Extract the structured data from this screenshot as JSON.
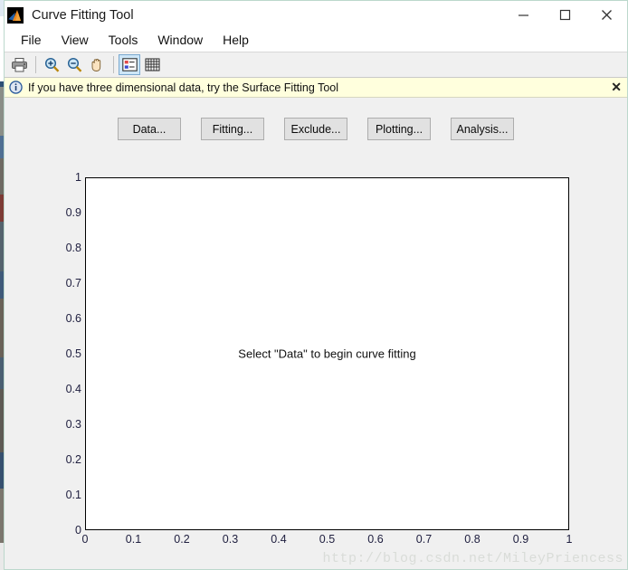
{
  "window": {
    "title": "Curve Fitting Tool",
    "icon": "matlab-logo-icon",
    "controls": {
      "minimize": "minimize-icon",
      "maximize": "maximize-icon",
      "close": "close-icon"
    }
  },
  "menu": {
    "items": [
      {
        "label": "File"
      },
      {
        "label": "View"
      },
      {
        "label": "Tools"
      },
      {
        "label": "Window"
      },
      {
        "label": "Help"
      }
    ]
  },
  "toolbar": {
    "buttons": [
      {
        "name": "print-icon",
        "title": "Print"
      },
      {
        "name": "zoom-in-icon",
        "title": "Zoom In"
      },
      {
        "name": "zoom-out-icon",
        "title": "Zoom Out"
      },
      {
        "name": "pan-hand-icon",
        "title": "Pan"
      },
      {
        "name": "legend-icon",
        "title": "Legend",
        "selected": true
      },
      {
        "name": "grid-icon",
        "title": "Grid"
      }
    ]
  },
  "info_bar": {
    "icon": "info-circle-icon",
    "message": "If you have three dimensional data, try the Surface Fitting Tool",
    "close_label": "✕",
    "background": "#ffffdd"
  },
  "actions": {
    "buttons": [
      {
        "label": "Data..."
      },
      {
        "label": "Fitting..."
      },
      {
        "label": "Exclude..."
      },
      {
        "label": "Plotting..."
      },
      {
        "label": "Analysis..."
      }
    ]
  },
  "plot": {
    "message": "Select \"Data\" to begin curve fitting",
    "background": "#ffffff",
    "axis_color": "#000000",
    "tick_label_color": "#202040"
  },
  "watermark": {
    "text": "http://blog.csdn.net/MileyPriencess",
    "color": "#d9dcd8"
  },
  "chart_data": {
    "type": "scatter",
    "title": "",
    "xlabel": "",
    "ylabel": "",
    "xlim": [
      0,
      1
    ],
    "ylim": [
      0,
      1
    ],
    "grid": false,
    "legend": null,
    "series": [],
    "annotations": [
      "Select \"Data\" to begin curve fitting"
    ],
    "xticks": [
      0,
      0.1,
      0.2,
      0.3,
      0.4,
      0.5,
      0.6,
      0.7,
      0.8,
      0.9,
      1
    ],
    "yticks": [
      0,
      0.1,
      0.2,
      0.3,
      0.4,
      0.5,
      0.6,
      0.7,
      0.8,
      0.9,
      1
    ],
    "xtick_labels": [
      "0",
      "0.1",
      "0.2",
      "0.3",
      "0.4",
      "0.5",
      "0.6",
      "0.7",
      "0.8",
      "0.9",
      "1"
    ],
    "ytick_labels": [
      "0",
      "0.1",
      "0.2",
      "0.3",
      "0.4",
      "0.5",
      "0.6",
      "0.7",
      "0.8",
      "0.9",
      "1"
    ]
  }
}
